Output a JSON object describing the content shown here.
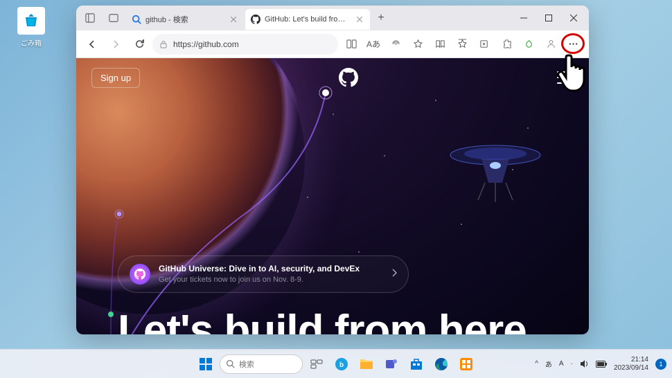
{
  "desktop": {
    "recycle_bin_label": "ごみ箱"
  },
  "browser": {
    "tabs": [
      {
        "title": "github - 検索",
        "type": "search"
      },
      {
        "title": "GitHub: Let's build from here · Gi",
        "type": "github",
        "active": true
      }
    ],
    "url": "https://github.com",
    "toolbar_aa": "Aあ",
    "toolbar_read": "A"
  },
  "github": {
    "signup": "Sign up",
    "promo_title": "GitHub Universe: Dive in to AI, security, and DevEx",
    "promo_sub": "Get your tickets now to join us on Nov. 8-9.",
    "hero": "Let's build from here"
  },
  "taskbar": {
    "search_placeholder": "検索",
    "ime_a": "A",
    "time": "21:14",
    "date": "2023/09/14",
    "notif_count": "1",
    "arrow": "^",
    "lang": "あ"
  }
}
